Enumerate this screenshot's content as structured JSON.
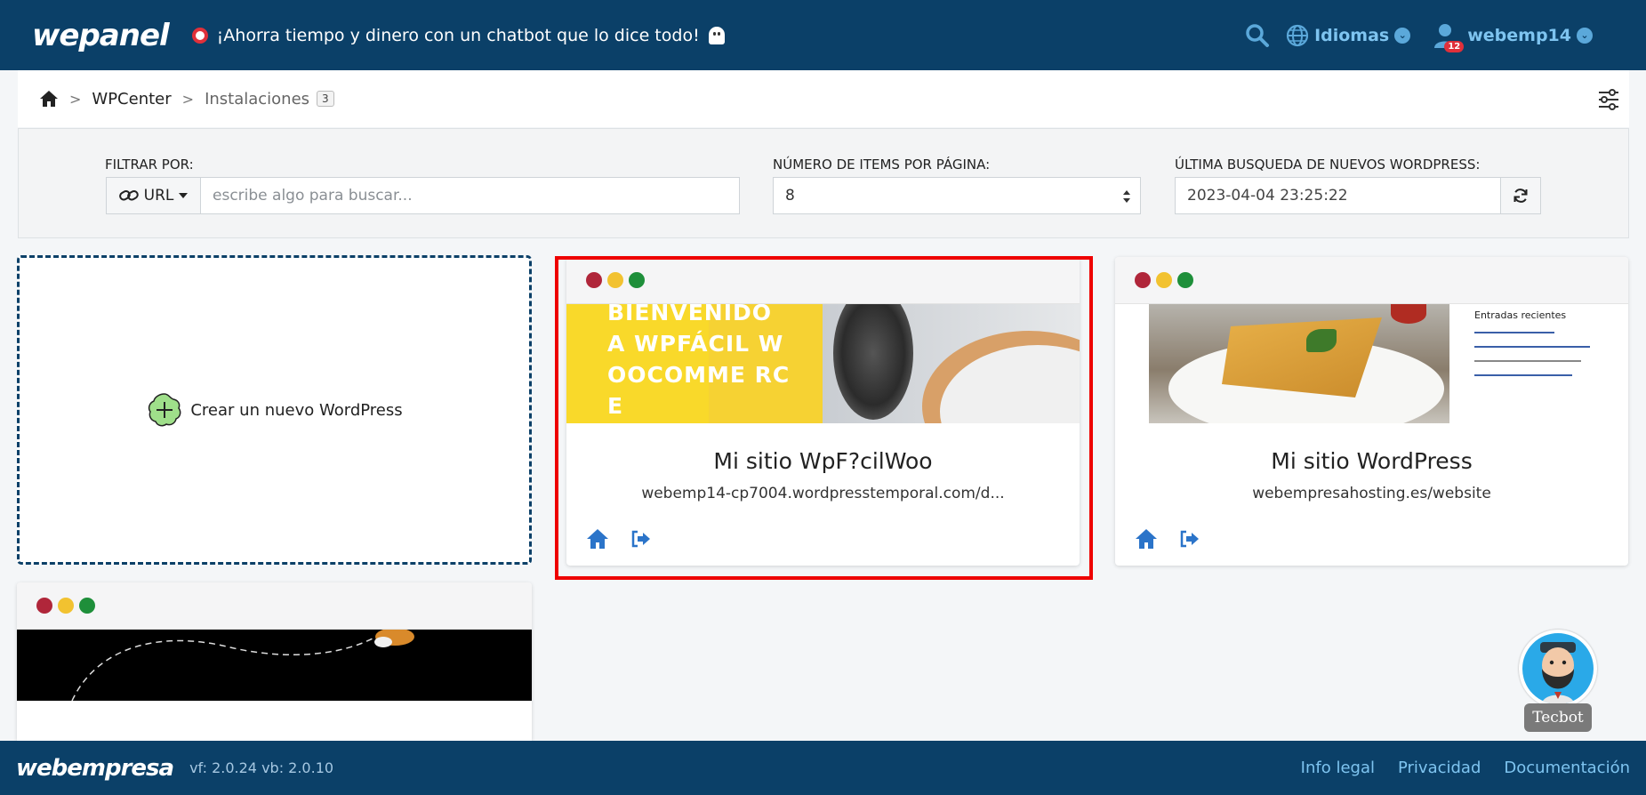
{
  "header": {
    "logo": "wepanel",
    "promo_text": "¡Ahorra tiempo y dinero con un chatbot que lo dice todo!",
    "languages_label": "Idiomas",
    "user_label": "webemp14",
    "notification_count": "12"
  },
  "breadcrumb": {
    "section": "WPCenter",
    "current": "Instalaciones",
    "count": "3"
  },
  "filters": {
    "filter_label": "FILTRAR POR:",
    "filter_type": "URL",
    "search_placeholder": "escribe algo para buscar...",
    "items_label": "NÚMERO DE ITEMS POR PÁGINA:",
    "items_value": "8",
    "last_search_label": "ÚLTIMA BUSQUEDA DE NUEVOS WORDPRESS:",
    "last_search_value": "2023-04-04 23:25:22"
  },
  "new_card": {
    "label": "Crear un nuevo WordPress"
  },
  "sites": [
    {
      "title": "Mi sitio WpF?cilWoo",
      "url": "webemp14-cp7004.wordpresstemporal.com/d...",
      "thumb_text": "BIENVENIDO A WPFÁCIL WOOCOMME RCE"
    },
    {
      "title": "Mi sitio WordPress",
      "url": "webempresahosting.es/website",
      "thumb_sidebar_title": "Entradas recientes"
    }
  ],
  "footer": {
    "logo": "webempresa",
    "version": "vf: 2.0.24 vb: 2.0.10",
    "links": [
      "Info legal",
      "Privacidad",
      "Documentación"
    ]
  },
  "chatbot": {
    "label": "Tecbot"
  },
  "colors": {
    "primary": "#0b4068",
    "accent_link": "#7ec4f0",
    "highlight": "#ee0000"
  }
}
